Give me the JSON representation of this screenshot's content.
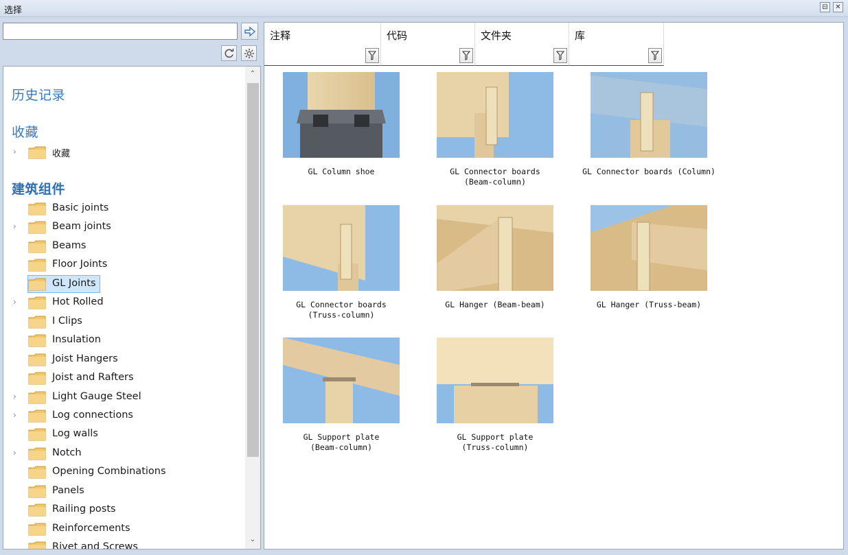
{
  "window": {
    "title": "选择"
  },
  "search": {
    "value": "",
    "placeholder": ""
  },
  "sections": {
    "history": "历史记录",
    "favorites": "收藏",
    "components": "建筑组件"
  },
  "favorites_folder": "收藏",
  "tree_items": [
    {
      "label": "Basic joints",
      "expandable": false
    },
    {
      "label": "Beam joints",
      "expandable": true
    },
    {
      "label": "Beams",
      "expandable": false
    },
    {
      "label": "Floor Joints",
      "expandable": false
    },
    {
      "label": "GL Joints",
      "expandable": false,
      "selected": true
    },
    {
      "label": "Hot Rolled",
      "expandable": true
    },
    {
      "label": "I Clips",
      "expandable": false
    },
    {
      "label": "Insulation",
      "expandable": false
    },
    {
      "label": "Joist Hangers",
      "expandable": false
    },
    {
      "label": "Joist and Rafters",
      "expandable": false
    },
    {
      "label": "Light Gauge Steel",
      "expandable": true
    },
    {
      "label": "Log connections",
      "expandable": true
    },
    {
      "label": "Log walls",
      "expandable": false
    },
    {
      "label": "Notch",
      "expandable": true
    },
    {
      "label": "Opening Combinations",
      "expandable": false
    },
    {
      "label": "Panels",
      "expandable": false
    },
    {
      "label": "Railing posts",
      "expandable": false
    },
    {
      "label": "Reinforcements",
      "expandable": false
    },
    {
      "label": "Rivet and Screws",
      "expandable": false
    }
  ],
  "columns": [
    {
      "label": "注释"
    },
    {
      "label": "代码"
    },
    {
      "label": "文件夹"
    },
    {
      "label": "库"
    }
  ],
  "thumbnails": [
    {
      "caption": "GL Column shoe"
    },
    {
      "caption": "GL Connector boards\n(Beam-column)"
    },
    {
      "caption": "GL Connector boards (Column)"
    },
    {
      "caption": "GL Connector boards\n(Truss-column)"
    },
    {
      "caption": "GL Hanger (Beam-beam)"
    },
    {
      "caption": "GL Hanger (Truss-beam)"
    },
    {
      "caption": "GL Support plate\n(Beam-column)"
    },
    {
      "caption": "GL Support plate\n(Truss-column)"
    }
  ],
  "icons": {
    "go": "arrow-right-icon",
    "refresh": "refresh-icon",
    "settings": "gear-icon",
    "filter": "filter-icon",
    "folder": "folder-icon"
  },
  "colors": {
    "accent": "#3a78bf",
    "selection": "#cfe6fb",
    "folder": "#f2c76b"
  }
}
